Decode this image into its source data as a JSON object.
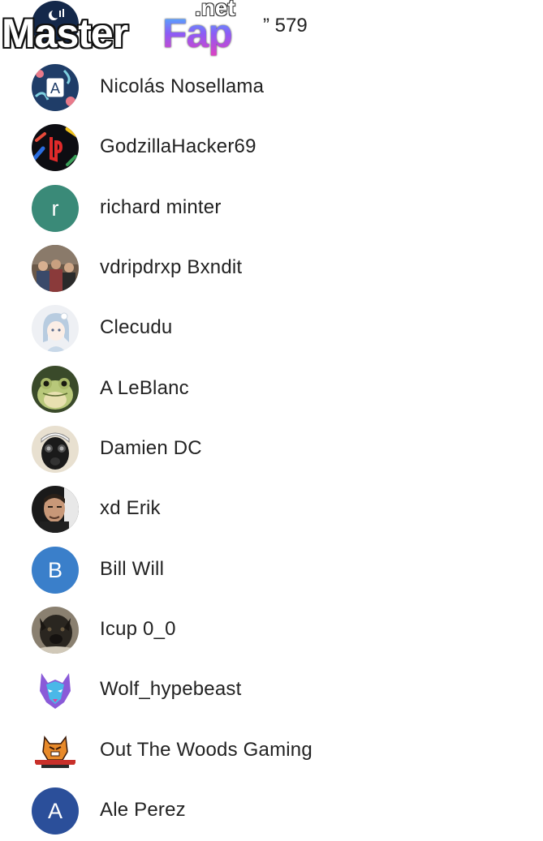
{
  "watermark": {
    "part1": "Master",
    "part2": "Fap",
    "suffix": ".net"
  },
  "top_row": {
    "count_text": "” 579"
  },
  "users": [
    {
      "name": "Nicolás Nosellama",
      "avatar": "a-logo-icon"
    },
    {
      "name": "GodzillaHacker69",
      "avatar": "playstation-icon"
    },
    {
      "name": "richard minter",
      "avatar": "letter",
      "letter": "r",
      "color": "#3a8a78"
    },
    {
      "name": "vdripdrxp Bxndit",
      "avatar": "group-photo-icon"
    },
    {
      "name": "Clecudu",
      "avatar": "anime-girl-icon"
    },
    {
      "name": "A LeBlanc",
      "avatar": "frog-icon"
    },
    {
      "name": "Damien DC",
      "avatar": "gas-mask-icon"
    },
    {
      "name": "xd Erik",
      "avatar": "man-face-icon"
    },
    {
      "name": "Bill Will",
      "avatar": "letter",
      "letter": "B",
      "color": "#3a7fca"
    },
    {
      "name": "Icup 0_0",
      "avatar": "dog-icon"
    },
    {
      "name": "Wolf_hypebeast",
      "avatar": "wolf-icon"
    },
    {
      "name": "Out The Woods Gaming",
      "avatar": "tiger-logo-icon"
    },
    {
      "name": "Ale Perez",
      "avatar": "letter",
      "letter": "A",
      "color": "#2b4f9a"
    }
  ]
}
